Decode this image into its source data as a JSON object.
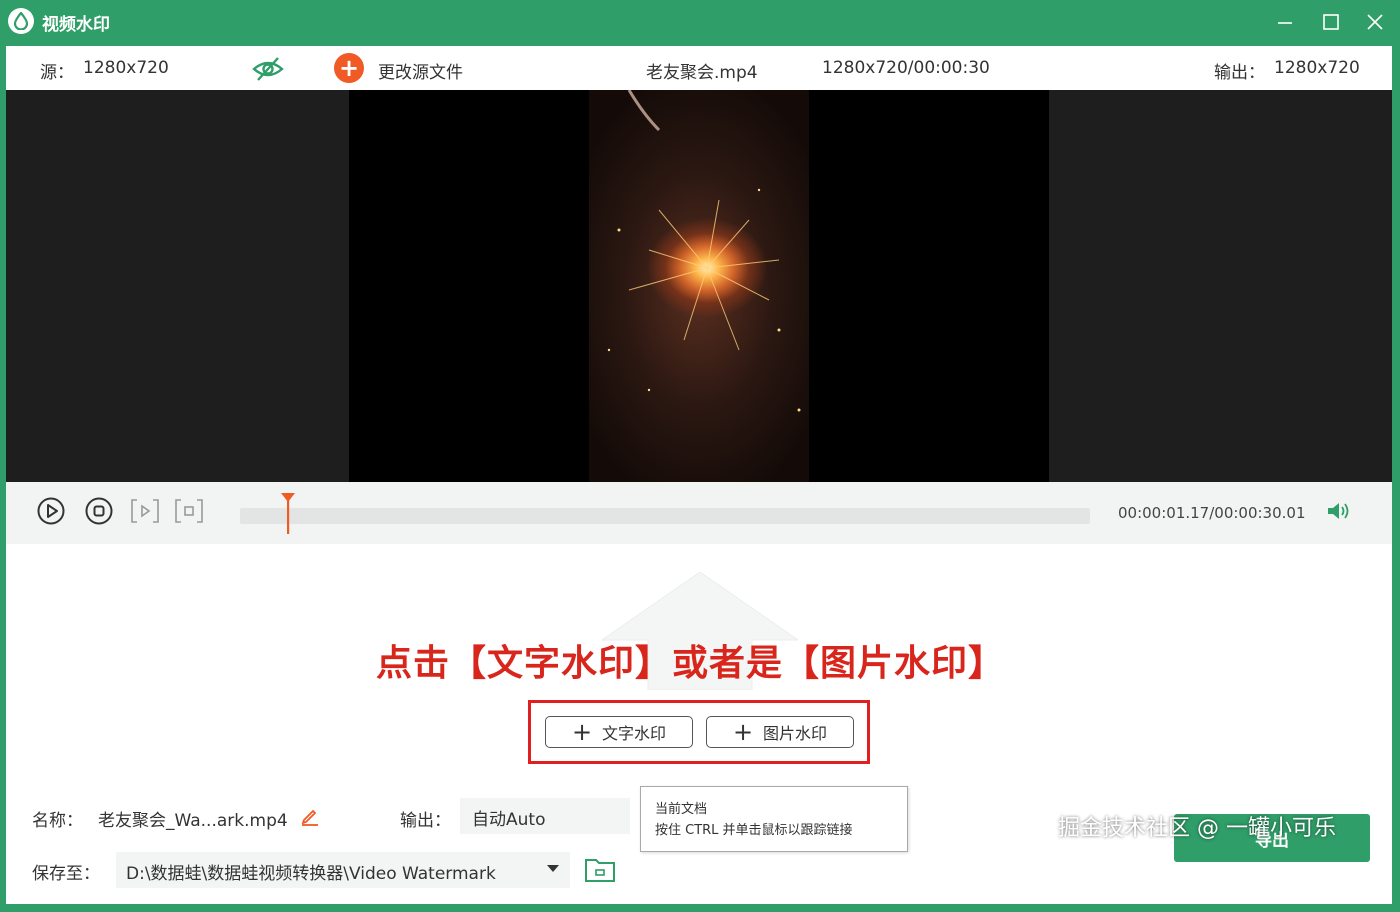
{
  "window": {
    "title": "视频水印"
  },
  "infobar": {
    "source_label": "源：",
    "source_res": "1280x720",
    "change_source": "更改源文件",
    "filename": "老友聚会.mp4",
    "file_info": "1280x720/00:00:30",
    "output_label": "输出：",
    "output_res": "1280x720"
  },
  "player": {
    "time": "00:00:01.17/00:00:30.01",
    "progress": 0.056
  },
  "annotation": "点击【文字水印】或者是【图片水印】",
  "buttons": {
    "text_watermark": "文字水印",
    "image_watermark": "图片水印",
    "export": "导出"
  },
  "tooltip": {
    "line1": "当前文档",
    "line2": "按住 CTRL 并单击鼠标以跟踪链接"
  },
  "bottom": {
    "name_label": "名称：",
    "name_value": "老友聚会_Wa...ark.mp4",
    "output_label": "输出：",
    "output_value": "自动Auto",
    "save_label": "保存至：",
    "save_path": "D:\\数据蛙\\数据蛙视频转换器\\Video Watermark"
  },
  "credit": "掘金技术社区 @ 一罐小可乐",
  "colors": {
    "brand": "#2f9e68",
    "accent_orange": "#f05a24",
    "annotation_red": "#d9261c"
  }
}
